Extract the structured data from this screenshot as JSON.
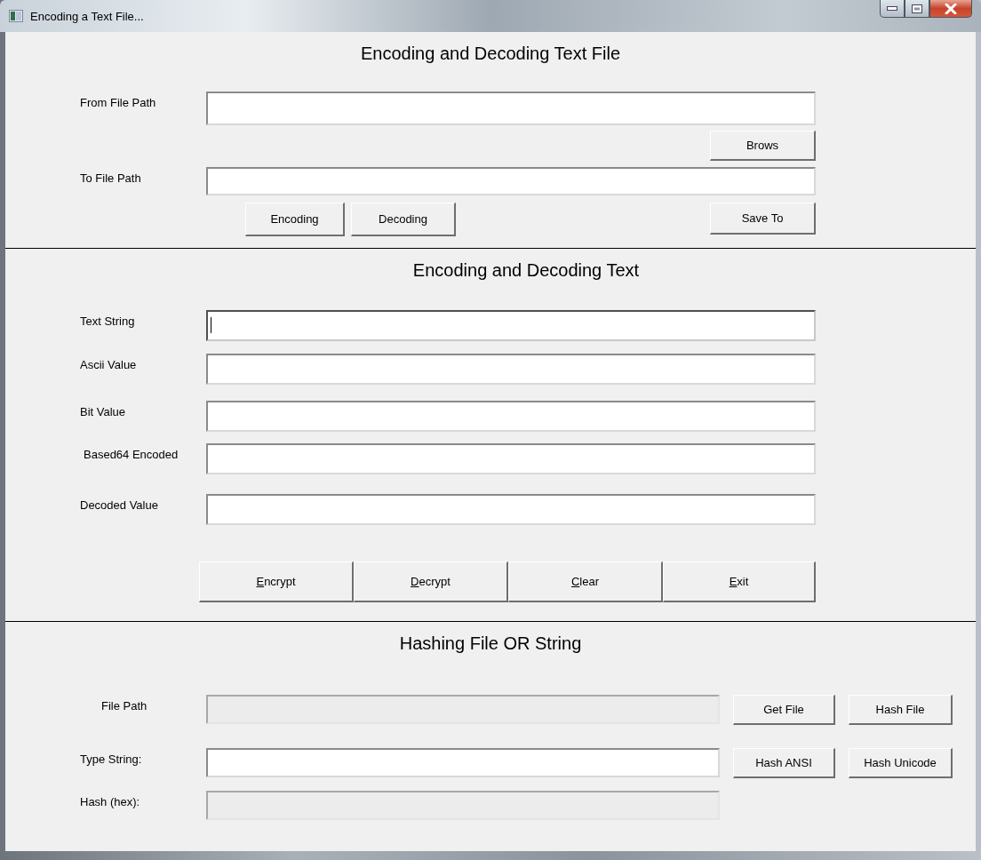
{
  "window": {
    "title": "Encoding a Text File..."
  },
  "file_section": {
    "heading": "Encoding and Decoding Text File",
    "rows": [
      {
        "label": "From File Path"
      },
      {
        "label": "To File Path"
      }
    ],
    "browse_button": "Brows",
    "action_buttons": [
      "Encoding",
      "Decoding"
    ],
    "save_button": "Save To"
  },
  "text_section": {
    "heading": "Encoding and Decoding Text",
    "fields": [
      {
        "label": "Text String",
        "focused": true
      },
      {
        "label": "Ascii Value",
        "focused": false
      },
      {
        "label": "Bit Value",
        "focused": false
      },
      {
        "label": "Based64 Encoded",
        "focused": false
      },
      {
        "label": "Decoded Value",
        "focused": false
      }
    ],
    "buttons": [
      {
        "label": "Encrypt",
        "mnemonic": true
      },
      {
        "label": "Decrypt",
        "mnemonic": true
      },
      {
        "label": "Clear",
        "mnemonic": true
      },
      {
        "label": "Exit",
        "mnemonic": true
      }
    ]
  },
  "hash_section": {
    "heading": "Hashing File OR String",
    "fields": [
      {
        "label": "File Path",
        "disabled": true,
        "buttons": [
          "Get File",
          "Hash File"
        ]
      },
      {
        "label": "Type String:",
        "disabled": false,
        "buttons": [
          "Hash ANSI",
          "Hash Unicode"
        ]
      },
      {
        "label": "Hash (hex):",
        "disabled": true
      }
    ]
  }
}
